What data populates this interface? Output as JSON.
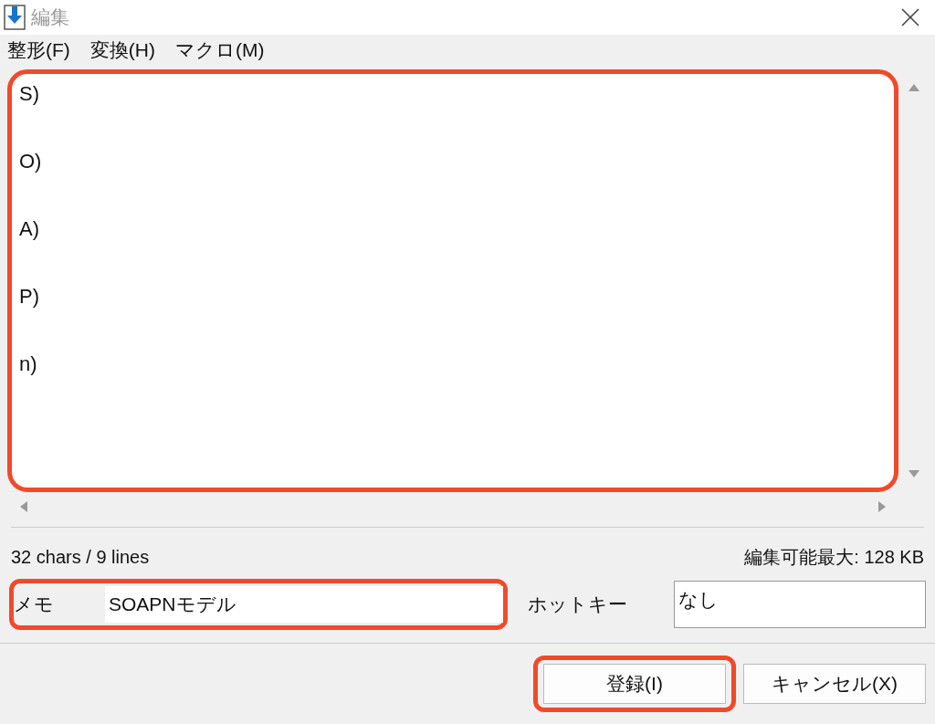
{
  "window": {
    "title": "編集"
  },
  "menu": [
    "整形(F)",
    "変換(H)",
    "マクロ(M)"
  ],
  "editor": {
    "lines": [
      "S)",
      "O)",
      "A)",
      "P)",
      "n)"
    ]
  },
  "status": {
    "count": "32 chars / 9 lines",
    "max": "編集可能最大: 128 KB"
  },
  "memo": {
    "label": "メモ",
    "value": "SOAPNモデル"
  },
  "hotkey": {
    "label": "ホットキー",
    "value": "なし"
  },
  "buttons": [
    {
      "label": "登録(I)",
      "highlighted": true
    },
    {
      "label": "キャンセル(X)",
      "highlighted": false
    }
  ]
}
